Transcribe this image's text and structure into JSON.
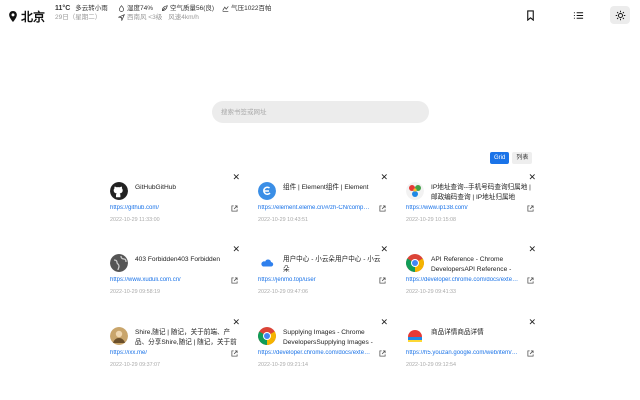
{
  "header": {
    "city": "北京",
    "temperature": "11°C",
    "condition": "多云转小雨",
    "date": "29日（星期二）",
    "humidity": "湿度74%",
    "air_quality": "空气质量56(良)",
    "pressure": "气压1022百帕",
    "wind_dir": "西南风 <3级",
    "wind_speed": "风速4km/h"
  },
  "search": {
    "placeholder": "搜索书签或网址"
  },
  "view_toggle": {
    "grid_label": "Grid",
    "list_label": "列表",
    "active": "grid"
  },
  "bookmarks": [
    {
      "title": "GitHubGitHub",
      "url": "https://github.com/",
      "time": "2022-10-29 11:33:00",
      "icon": "github-icon"
    },
    {
      "title": "组件 | Element组件 | Element",
      "url": "https://element.eleme.cn/#/zh-CN/component",
      "time": "2022-10-29 10:43:51",
      "icon": "element-icon"
    },
    {
      "title": "IP地址查询--手机号码查询归属地 | 邮政编码查询 | IP地址归属地",
      "url": "https://www.ip138.com/",
      "time": "2022-10-29 10:15:08",
      "icon": "ip138-icon"
    },
    {
      "title": "403 Forbidden403 Forbidden",
      "url": "https://www.xuduli.com.cn/",
      "time": "2022-10-29 09:58:19",
      "icon": "globe-icon"
    },
    {
      "title": "用户中心 - 小云朵用户中心 - 小云朵",
      "url": "https://jenmo.top/user",
      "time": "2022-10-29 09:47:06",
      "icon": "cloud-icon"
    },
    {
      "title": "API Reference - Chrome DevelopersAPI Reference - Chrome Developers",
      "url": "https://developer.chrome.com/docs/extensions/reference/",
      "time": "2022-10-29 09:41:33",
      "icon": "chrome-icon"
    },
    {
      "title": "Shire,随记 | 随记，关于前端、产品、分享Shire,随记 | 随记，关于前端、产品",
      "url": "https://ixx.me/",
      "time": "2022-10-29 09:37:07",
      "icon": "avatar-icon"
    },
    {
      "title": "Supplying Images - Chrome DevelopersSupplying Images - Chrome Developers",
      "url": "https://developer.chrome.com/docs/extensions/mv3/",
      "time": "2022-10-29 09:21:14",
      "icon": "chrome-icon"
    },
    {
      "title": "商品详情商品详情",
      "url": "https://h5.youzan.google.com/web/item/detail",
      "time": "2022-10-29 09:12:54",
      "icon": "shop-icon"
    }
  ],
  "colors": {
    "accent": "#1a73e8",
    "search_bg": "#ececec"
  }
}
